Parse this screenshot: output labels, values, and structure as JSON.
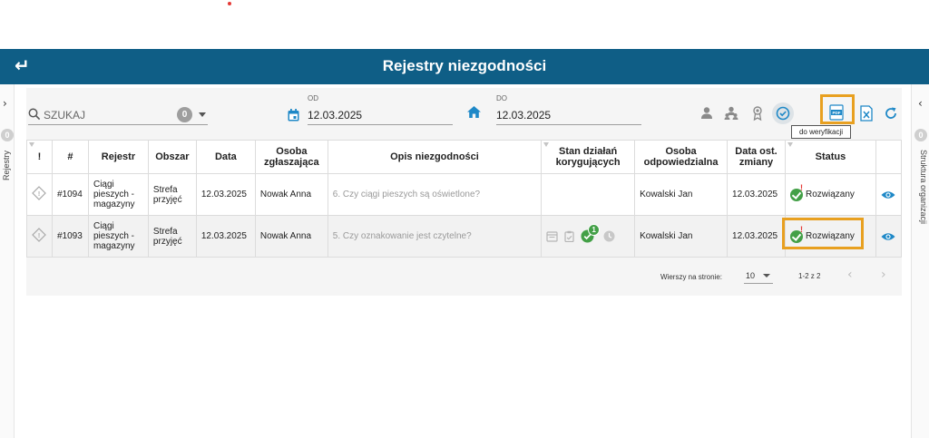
{
  "header": {
    "title": "Rejestry niezgodności",
    "back_icon": "back-arrow-icon"
  },
  "left_rail": {
    "badge": "0",
    "label": "Rejestry"
  },
  "right_rail": {
    "badge": "0",
    "label": "Struktura organizacji"
  },
  "search": {
    "placeholder": "SZUKAJ",
    "count": "0"
  },
  "date_from": {
    "label": "OD",
    "value": "12.03.2025"
  },
  "date_to": {
    "label": "DO",
    "value": "12.03.2025"
  },
  "tooltip": "do weryfikacji",
  "table": {
    "headers": {
      "flag": "!",
      "num": "#",
      "registry": "Rejestr",
      "area": "Obszar",
      "date": "Data",
      "reporter": "Osoba zgłaszająca",
      "description": "Opis niezgodności",
      "actions_state": "Stan działań korygujących",
      "responsible": "Osoba odpowiedzialna",
      "last_change": "Data ost. zmiany",
      "status": "Status"
    },
    "rows": [
      {
        "num": "#1094",
        "registry": "Ciągi pieszych - magazyny",
        "area": "Strefa przyjęć",
        "date": "12.03.2025",
        "reporter": "Nowak Anna",
        "description": "6. Czy ciągi pieszych są oświetlone?",
        "responsible": "Kowalski Jan",
        "last_change": "12.03.2025",
        "status": "Rozwiązany"
      },
      {
        "num": "#1093",
        "registry": "Ciągi pieszych - magazyny",
        "area": "Strefa przyjęć",
        "date": "12.03.2025",
        "reporter": "Nowak Anna",
        "description": "5. Czy oznakowanie jest czytelne?",
        "responsible": "Kowalski Jan",
        "last_change": "12.03.2025",
        "status": "Rozwiązany",
        "actions_badge": "1"
      }
    ]
  },
  "pager": {
    "rows_label": "Wierszy na stronie:",
    "rows_value": "10",
    "range": "1-2 z 2"
  },
  "colors": {
    "header": "#0f5e86",
    "accent": "#1e88c7",
    "success": "#43a047",
    "highlight": "#e8a020"
  }
}
